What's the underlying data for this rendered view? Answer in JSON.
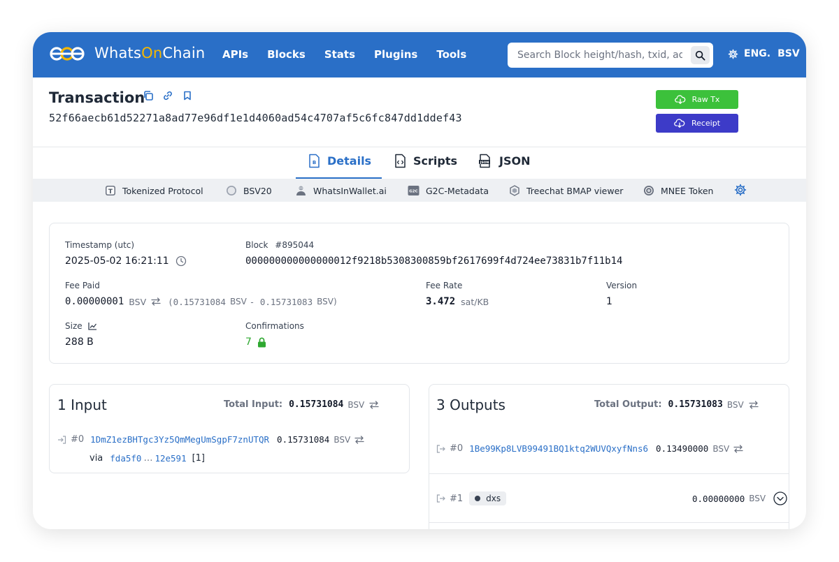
{
  "header": {
    "brand_pre": "Whats",
    "brand_on": "On",
    "brand_post": "Chain",
    "nav": [
      "APIs",
      "Blocks",
      "Stats",
      "Plugins",
      "Tools"
    ],
    "search_placeholder": "Search Block height/hash, txid, address",
    "language": "ENG.",
    "currency": "BSV"
  },
  "transaction": {
    "title": "Transaction",
    "txid": "52f66aecb61d52271a8ad77e96df1e1d4060ad54c4707af5c6fc847dd1ddef43",
    "raw_tx_label": "Raw Tx",
    "receipt_label": "Receipt"
  },
  "tabs": [
    "Details",
    "Scripts",
    "JSON"
  ],
  "plugins": [
    "Tokenized Protocol",
    "BSV20",
    "WhatsInWallet.ai",
    "G2C-Metadata",
    "Treechat BMAP viewer",
    "MNEE Token"
  ],
  "summary": {
    "timestamp_label": "Timestamp (utc)",
    "timestamp_value": "2025-05-02 16:21:11",
    "block_label": "Block",
    "block_number": "#895044",
    "block_hash": "000000000000000012f9218b5308300859bf2617699f4d724ee73831b7f11b14",
    "fee_paid_label": "Fee Paid",
    "fee_paid_value": "0.00000001",
    "fee_paid_unit": "BSV",
    "fee_paid_detail_open": "(0.15731084",
    "fee_paid_detail_bsv1": "BSV",
    "fee_paid_detail_minus": "- 0.15731083",
    "fee_paid_detail_close": "BSV)",
    "fee_rate_label": "Fee Rate",
    "fee_rate_value": "3.472",
    "fee_rate_unit": "sat/KB",
    "version_label": "Version",
    "version_value": "1",
    "size_label": "Size",
    "size_value": "288 B",
    "confirmations_label": "Confirmations",
    "confirmations_value": "7"
  },
  "inputs": {
    "title": "1 Input",
    "total_label": "Total Input:",
    "total_value": "0.15731084",
    "unit": "BSV",
    "items": [
      {
        "index": "#0",
        "address": "1DmZ1ezBHTgc3Yz5QmMegUmSgpF7znUTQR",
        "amount": "0.15731084",
        "unit": "BSV",
        "via_label": "via",
        "via_start": "fda5f0",
        "via_ellipsis": "…",
        "via_end": "12e591",
        "via_vout": "[1]"
      }
    ]
  },
  "outputs": {
    "title": "3 Outputs",
    "total_label": "Total Output:",
    "total_value": "0.15731083",
    "unit": "BSV",
    "items": [
      {
        "index": "#0",
        "address": "1Be99Kp8LVB99491BQ1ktq2WUVQxyfNns6",
        "amount": "0.13490000",
        "unit": "BSV"
      },
      {
        "index": "#1",
        "badge": "dxs",
        "amount": "0.00000000",
        "unit": "BSV"
      }
    ]
  },
  "colors": {
    "header_blue": "#2a6fc7",
    "raw_tx_green": "#3cc13b",
    "receipt_indigo": "#3d3bc8",
    "confirm_green": "#2fa831",
    "accent_yellow": "#f5b700"
  }
}
